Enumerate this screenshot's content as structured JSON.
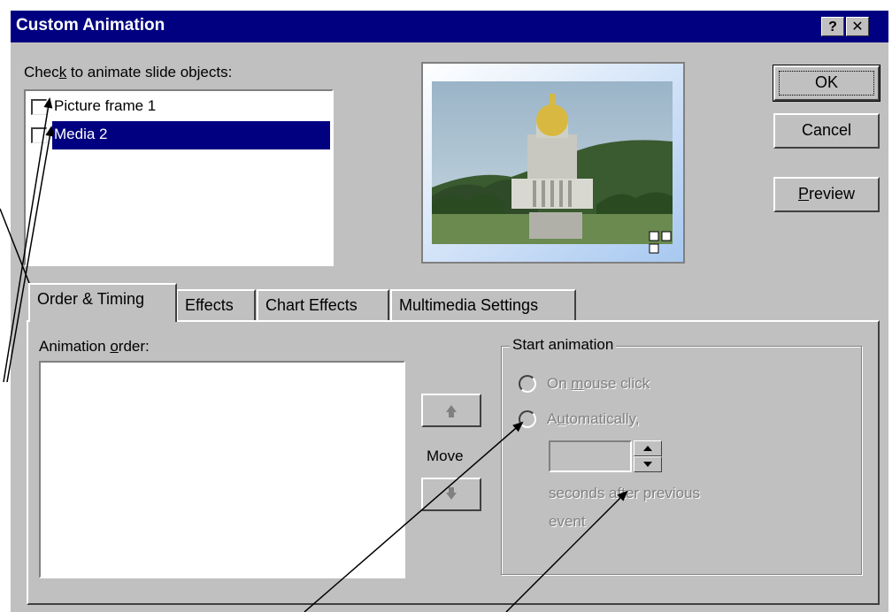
{
  "dialog": {
    "title": "Custom Animation",
    "help_button": "?",
    "close_button": "✕"
  },
  "objects": {
    "label_pre": "Chec",
    "label_ul": "k",
    "label_post": " to animate slide objects:",
    "items": [
      {
        "label": "Picture frame 1",
        "checked": false,
        "selected": false
      },
      {
        "label": "Media 2",
        "checked": false,
        "selected": true
      }
    ]
  },
  "buttons": {
    "ok": "OK",
    "cancel": "Cancel",
    "preview_ul": "P",
    "preview_rest": "review"
  },
  "tabs": [
    {
      "label": "Order & Timing",
      "active": true
    },
    {
      "label": "Effects",
      "active": false
    },
    {
      "label": "Chart Effects",
      "active": false
    },
    {
      "label": "Multimedia Settings",
      "active": false
    }
  ],
  "order": {
    "label_pre": "Animation ",
    "label_ul": "o",
    "label_post": "rder:",
    "move_label": "Move"
  },
  "start": {
    "group_label": "Start animation",
    "mouse_pre": "On ",
    "mouse_ul": "m",
    "mouse_post": "ouse click",
    "auto_pre": "A",
    "auto_ul": "u",
    "auto_post": "tomatically,",
    "seconds_value": "",
    "seconds_line1": "seconds after previous",
    "seconds_line2": "event"
  },
  "colors": {
    "titlebar": "#000080",
    "face": "#c0c0c0",
    "selection": "#000080",
    "disabled_text": "#808080"
  }
}
